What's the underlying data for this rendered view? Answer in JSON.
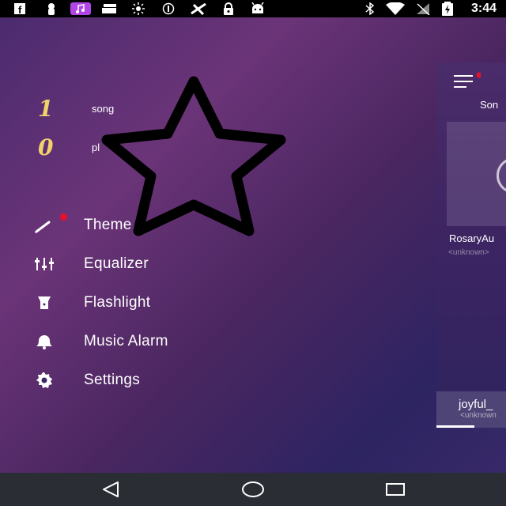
{
  "status_bar": {
    "time": "3:44",
    "left_icons": [
      "facebook-icon",
      "bug-icon",
      "music-note-icon",
      "cards-icon",
      "sun-icon",
      "dnd-icon",
      "satellite-icon",
      "lock-icon",
      "android-icon"
    ],
    "right_icons": [
      "bluetooth-icon",
      "wifi-icon",
      "signal-off-icon",
      "battery-charging-icon"
    ]
  },
  "drawer": {
    "stats": [
      {
        "number": "1",
        "label": "song"
      },
      {
        "number": "0",
        "label": "pl"
      }
    ],
    "menu": [
      {
        "label": "Theme",
        "icon": "brush-icon",
        "badge": true
      },
      {
        "label": "Equalizer",
        "icon": "equalizer-icon",
        "badge": false
      },
      {
        "label": "Flashlight",
        "icon": "flashlight-icon",
        "badge": false
      },
      {
        "label": "Music Alarm",
        "icon": "bell-icon",
        "badge": false
      },
      {
        "label": "Settings",
        "icon": "gear-icon",
        "badge": false
      }
    ],
    "overlay_icon": "star-outline-icon"
  },
  "panel": {
    "tab_label": "Son",
    "song_title": "RosaryAu",
    "song_artist": "<unknown>",
    "mini_player": {
      "title": "joyful_",
      "artist": "<unknown",
      "progress": 0.55
    }
  },
  "colors": {
    "accent_number": "#f2d36b",
    "badge": "#e8112c",
    "nav_bar": "#2b2d35"
  },
  "nav_bar": {
    "buttons": [
      "back-icon",
      "home-icon",
      "recents-icon"
    ]
  }
}
